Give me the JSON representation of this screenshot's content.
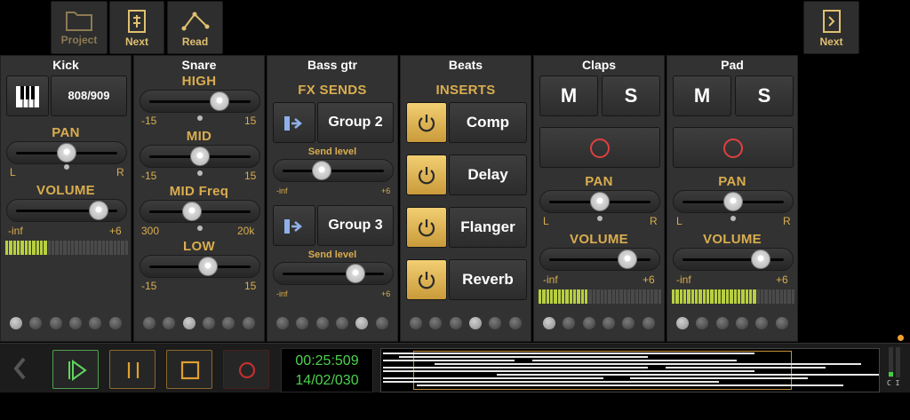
{
  "toolbar": {
    "project": "Project",
    "next": "Next",
    "read": "Read",
    "next_right": "Next"
  },
  "strips": {
    "kick": {
      "title": "Kick",
      "instrument": "808/909",
      "pan_label": "PAN",
      "pan_left": "L",
      "pan_right": "R",
      "volume_label": "VOLUME",
      "vol_min": "-inf",
      "vol_max": "+6"
    },
    "snare": {
      "title": "Snare",
      "bands": [
        {
          "label": "HIGH",
          "min": "-15",
          "max": "15"
        },
        {
          "label": "MID",
          "min": "-15",
          "max": "15"
        },
        {
          "label": "MID Freq",
          "min": "300",
          "max": "20k"
        },
        {
          "label": "LOW",
          "min": "-15",
          "max": "15"
        }
      ]
    },
    "bass": {
      "title": "Bass gtr",
      "section": "FX SENDS",
      "sends": [
        {
          "group": "Group 2",
          "label": "Send level",
          "min": "-inf",
          "max": "+6"
        },
        {
          "group": "Group 3",
          "label": "Send level",
          "min": "-inf",
          "max": "+6"
        }
      ]
    },
    "beats": {
      "title": "Beats",
      "section": "INSERTS",
      "inserts": [
        "Comp",
        "Delay",
        "Flanger",
        "Reverb"
      ]
    },
    "claps": {
      "title": "Claps",
      "mute": "M",
      "solo": "S",
      "pan_label": "PAN",
      "pan_left": "L",
      "pan_right": "R",
      "volume_label": "VOLUME",
      "vol_min": "-inf",
      "vol_max": "+6"
    },
    "pad": {
      "title": "Pad",
      "mute": "M",
      "solo": "S",
      "pan_label": "PAN",
      "pan_left": "L",
      "pan_right": "R",
      "volume_label": "VOLUME",
      "vol_min": "-inf",
      "vol_max": "+6"
    }
  },
  "levels": {
    "kick_pan": 0.5,
    "kick_volume": 0.82,
    "kick_meter_lit": 11,
    "snare_high": 0.7,
    "snare_mid": 0.5,
    "snare_midfreq": 0.42,
    "snare_low": 0.58,
    "bass_send1": 0.38,
    "bass_send2": 0.72,
    "claps_pan": 0.5,
    "claps_volume": 0.78,
    "claps_meter_lit": 13,
    "pad_pan": 0.5,
    "pad_volume": 0.78,
    "pad_meter_lit": 22
  },
  "transport": {
    "time": "00:25:509",
    "date": "14/02/030"
  },
  "corner_label": "C I",
  "colors": {
    "accent": "#d9ad4f",
    "insert_on": "#e8c060",
    "record": "#e04040",
    "clock": "#4dd34d"
  },
  "icons": {
    "project": "folder-icon",
    "next": "next-score-icon",
    "read": "read-graph-icon",
    "back": "chevron-left-icon",
    "play": "play-icon",
    "pause": "pause-icon",
    "stop": "stop-icon",
    "record": "record-icon"
  }
}
